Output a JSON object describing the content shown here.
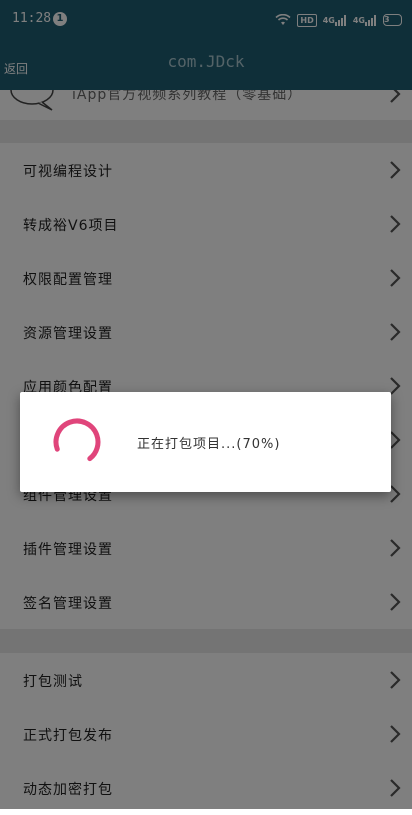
{
  "status": {
    "time": "11:28",
    "notif_count": "1",
    "hd": "HD",
    "net1": "4G",
    "net2": "4G",
    "battery": "3"
  },
  "appbar": {
    "back_label": "返回",
    "title": "com.JDck"
  },
  "top_item_label": "iApp官方视频系列教程（零基础）",
  "groups": [
    {
      "items": [
        {
          "label": "可视编程设计"
        },
        {
          "label": "转成裕V6项目"
        },
        {
          "label": "权限配置管理"
        },
        {
          "label": "资源管理设置"
        },
        {
          "label": "应用颜色配置"
        },
        {
          "label": ""
        },
        {
          "label": "组件管理设置"
        },
        {
          "label": "插件管理设置"
        },
        {
          "label": "签名管理设置"
        }
      ]
    },
    {
      "items": [
        {
          "label": "打包测试"
        },
        {
          "label": "正式打包发布"
        },
        {
          "label": "动态加密打包"
        }
      ]
    }
  ],
  "dialog": {
    "message": "正在打包项目...(70%)",
    "progress": 0.7,
    "spinner_color": "#e0457b"
  },
  "colors": {
    "appbar": "#1e5e73"
  }
}
